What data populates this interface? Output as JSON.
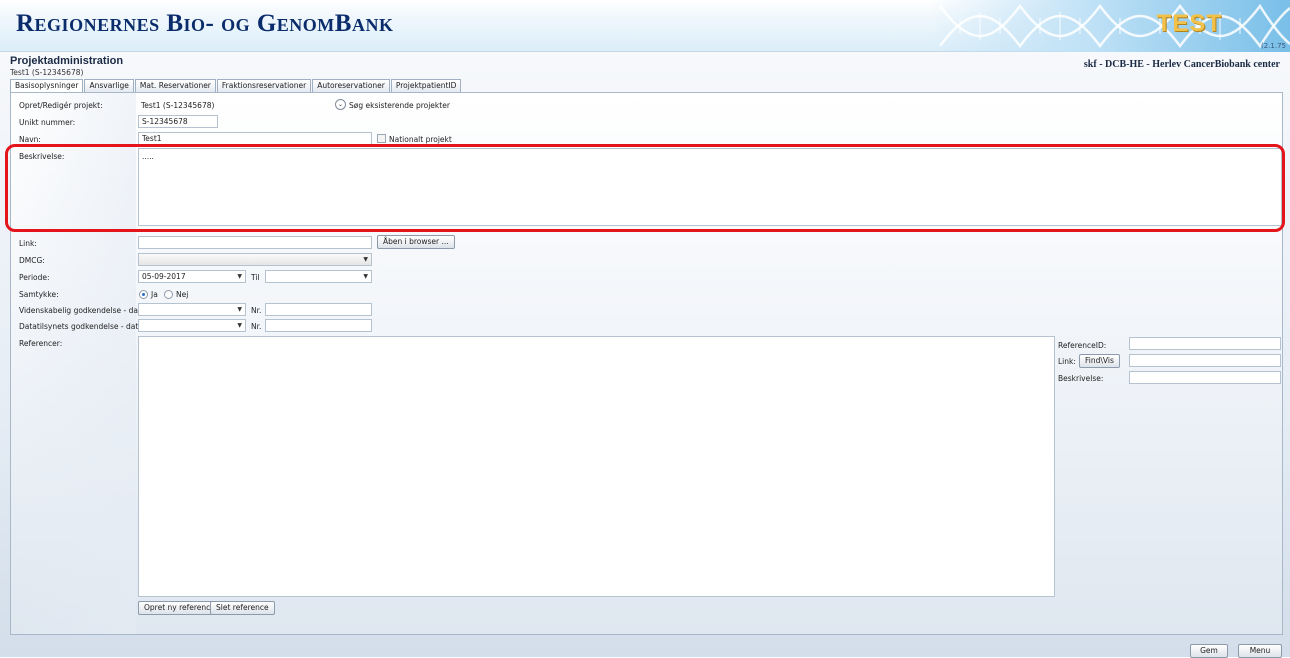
{
  "app": {
    "banner_title": "Regionernes Bio- og GenomBank",
    "banner_badge": "Test",
    "version": "(2.1.75",
    "page_title": "Projektadministration",
    "page_subtitle": "Test1 (S-12345678)",
    "user_context": "skf - DCB-HE - Herlev CancerBiobank center"
  },
  "tabs": [
    {
      "label": "Basisoplysninger",
      "active": true
    },
    {
      "label": "Ansvarlige"
    },
    {
      "label": "Mat. Reservationer"
    },
    {
      "label": "Fraktionsreservationer"
    },
    {
      "label": "Autoreservationer"
    },
    {
      "label": "ProjektpatientID"
    }
  ],
  "form": {
    "opret_label": "Opret/Redigér projekt:",
    "opret_value": "Test1 (S-12345678)",
    "search_label": "Søg eksisterende projekter",
    "unikt_label": "Unikt nummer:",
    "unikt_value": "S-12345678",
    "navn_label": "Navn:",
    "navn_value": "Test1",
    "nationalt_label": "Nationalt projekt",
    "beskrivelse_label": "Beskrivelse:",
    "beskrivelse_value": ".....",
    "link_label": "Link:",
    "link_value": "",
    "open_browser_label": "Åben i browser ...",
    "dmcg_label": "DMCG:",
    "dmcg_value": "",
    "periode_label": "Periode:",
    "periode_from": "05-09-2017",
    "til_label": "Til",
    "periode_to": "",
    "samtykke_label": "Samtykke:",
    "samtykke_ja": "Ja",
    "samtykke_nej": "Nej",
    "samtykke_selected": "Ja",
    "vid_label": "Videnskabelig godkendelse - dato:",
    "vid_date": "",
    "nr_label": "Nr.",
    "vid_nr": "",
    "data_label": "Datatilsynets godkendelse - dato:",
    "data_date": "",
    "data_nr": "",
    "referencer_label": "Referencer:",
    "opret_ref_label": "Opret ny reference",
    "slet_ref_label": "Slet reference"
  },
  "reference_panel": {
    "refid_label": "ReferenceID:",
    "refid_value": "",
    "link_label": "Link:",
    "find_label": "Find\\Vis",
    "link_value": "",
    "beskrivelse_label": "Beskrivelse:",
    "beskrivelse_value": ""
  },
  "footer": {
    "gem_label": "Gem",
    "menu_label": "Menu"
  },
  "colors": {
    "banner_title": "#0a2c6b",
    "highlight": "#e4141b",
    "badge": "#f2c14a"
  }
}
